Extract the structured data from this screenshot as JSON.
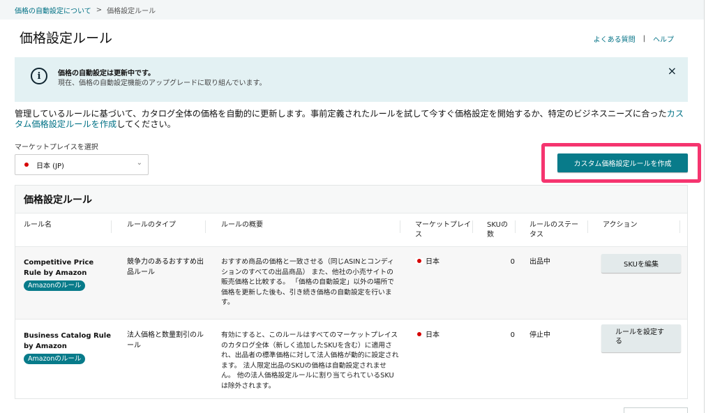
{
  "breadcrumb": {
    "parent": "価格の自動設定について",
    "separator": ">",
    "current": "価格設定ルール"
  },
  "header": {
    "title": "価格設定ルール",
    "faq_link": "よくある質問",
    "divider": "|",
    "help_link": "ヘルプ"
  },
  "banner": {
    "icon": "info-icon",
    "title": "価格の自動設定は更新中です。",
    "text": "現在、価格の自動設定機能のアップグレードに取り組んでいます。",
    "close_icon": "×"
  },
  "intro": {
    "text_before": "管理しているルールに基づいて、カタログ全体の価格を自動的に更新します。事前定義されたルールを試して今すぐ価格設定を開始するか、特定のビジネスニーズに合った",
    "link": "カスタム価格設定ルールを作成",
    "text_after": "してください。"
  },
  "marketplace": {
    "label": "マーケットプレイスを選択",
    "selected": "日本 (JP)",
    "chevron": "⌄"
  },
  "create_button": "カスタム価格設定ルールを作成",
  "table": {
    "title": "価格設定ルール",
    "columns": [
      "ルール名",
      "ルールのタイプ",
      "ルールの概要",
      "マーケットプレイス",
      "SKUの数",
      "ルールのステータス",
      "アクション"
    ],
    "rows": [
      {
        "name": "Competitive Price Rule by Amazon",
        "badge": "Amazonのルール",
        "type": "競争力のあるおすすめ出品ルール",
        "summary": "おすすめ商品の価格と一致させる（同じASINとコンディションのすべての出品商品） また、他社の小売サイトの販売価格と比較する。 「価格の自動設定」以外の場所で価格を更新した後も、引き続き価格の自動設定を行います。",
        "marketplace": "日本",
        "sku_count": "0",
        "status": "出品中",
        "action": "SKUを編集"
      },
      {
        "name": "Business Catalog Rule by Amazon",
        "badge": "Amazonのルール",
        "type": "法人価格と数量割引のルール",
        "summary": "有効にすると、このルールはすべてのマーケットプレイスのカタログ全体（新しく追加したSKUを含む）に適用され、出品者の標準価格に対して法人価格が動的に設定されます。 法人限定出品のSKUの価格は自動設定されません。 他の法人価格設定ルールに割り当てられているSKUは除外されます。",
        "marketplace": "日本",
        "sku_count": "0",
        "status": "停止中",
        "action": "ルールを設定する"
      }
    ]
  },
  "colors": {
    "accent": "#087b8a",
    "link": "#007185",
    "highlight": "#f5356f",
    "banner_bg": "#e3f1f3"
  }
}
